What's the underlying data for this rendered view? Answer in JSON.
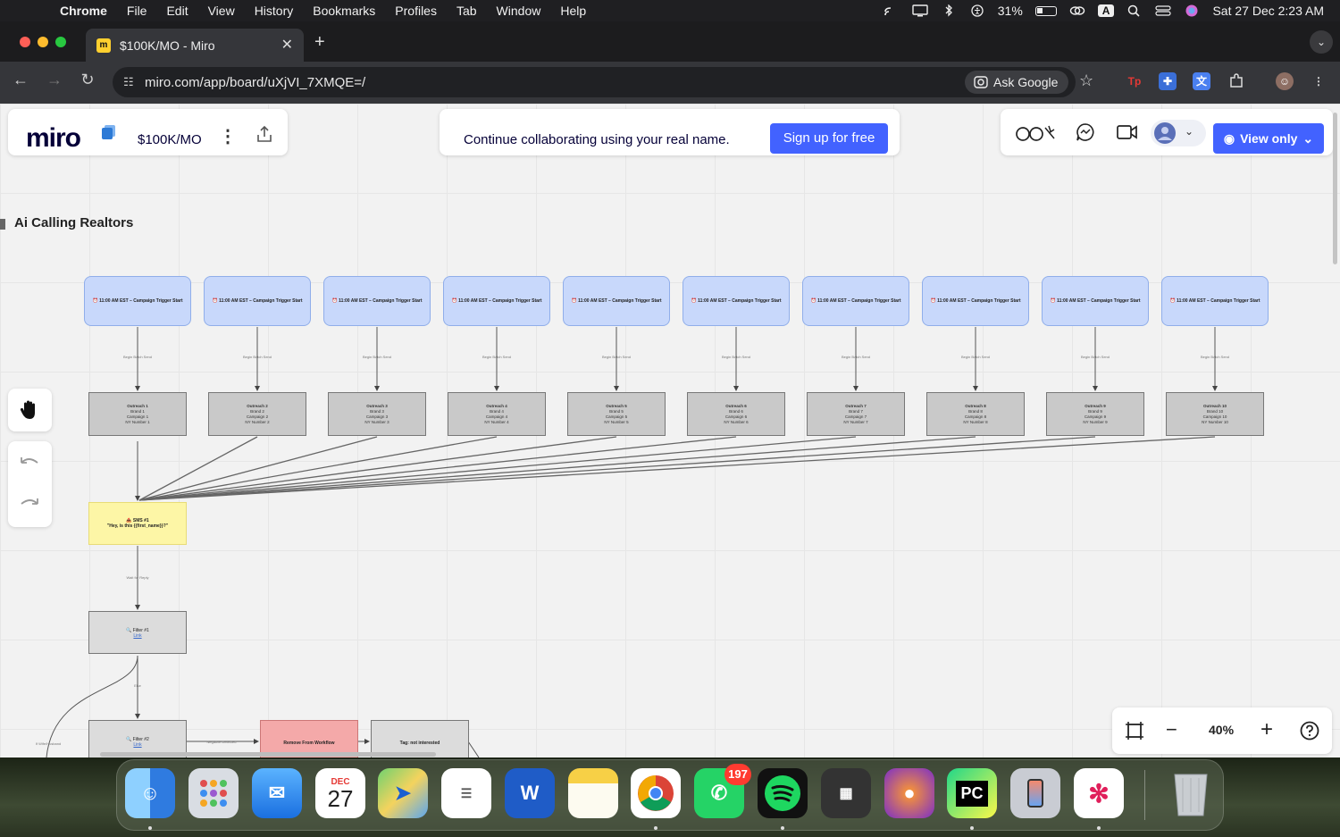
{
  "menubar": {
    "app": "Chrome",
    "items": [
      "File",
      "Edit",
      "View",
      "History",
      "Bookmarks",
      "Profiles",
      "Tab",
      "Window",
      "Help"
    ],
    "battery": "31%",
    "input_source": "A",
    "datetime": "Sat 27 Dec  2:23 AM"
  },
  "browser": {
    "tab_title": "$100K/MO - Miro",
    "tab_favicon": "m",
    "url": "miro.com/app/board/uXjVI_7XMQE=/",
    "ask_google": "Ask Google",
    "extension_tp": "Tp"
  },
  "miro": {
    "logo": "miro",
    "board_name": "$100K/MO",
    "banner_text": "Continue collaborating using your real name.",
    "signup_label": "Sign up for free",
    "view_only_label": "View only",
    "frame_title": "Ai Calling Realtors",
    "zoom_level": "40%",
    "trigger_label": "⏰ 11:00 AM EST – Campaign Trigger Start",
    "edge_label": "Begin Batch Send",
    "outreach": [
      {
        "title": "Outreach 1",
        "lines": [
          "Brand 1",
          "Campaign 1",
          "NY Number 1"
        ]
      },
      {
        "title": "Outreach 2",
        "lines": [
          "Brand 2",
          "Campaign 2",
          "NY Number 2"
        ]
      },
      {
        "title": "Outreach 3",
        "lines": [
          "Brand 3",
          "Campaign 3",
          "NY Number 3"
        ]
      },
      {
        "title": "Outreach 4",
        "lines": [
          "Brand 4",
          "Campaign 4",
          "NY Number 4"
        ]
      },
      {
        "title": "Outreach 5",
        "lines": [
          "Brand 5",
          "Campaign 5",
          "NY Number 5"
        ]
      },
      {
        "title": "Outreach 6",
        "lines": [
          "Brand 6",
          "Campaign 6",
          "NY Number 6"
        ]
      },
      {
        "title": "Outreach 7",
        "lines": [
          "Brand 7",
          "Campaign 7",
          "NY Number 7"
        ]
      },
      {
        "title": "Outreach 8",
        "lines": [
          "Brand 8",
          "Campaign 8",
          "NY Number 8"
        ]
      },
      {
        "title": "Outreach 9",
        "lines": [
          "Brand 9",
          "Campaign 9",
          "NY Number 9"
        ]
      },
      {
        "title": "Outreach 10",
        "lines": [
          "Brand 10",
          "Campaign 10",
          "NY Number 10"
        ]
      }
    ],
    "sms": {
      "title": "📤 SMS #1",
      "body": "\"Hey, is this {{first_name}}?\""
    },
    "wait_label": "Wait for Reply",
    "filter1": {
      "title": "🔍 Filter #1",
      "link": "Link"
    },
    "else_label": "Else",
    "filter2": {
      "title": "🔍 Filter #2",
      "link": "Link"
    },
    "negative_label": "Negative Detected",
    "if_wife_label": "If Wife/Husband",
    "remove_label": "Remove From Workflow",
    "tag_label": "Tag: not interested"
  },
  "dock": {
    "calendar_month": "DEC",
    "calendar_day": "27",
    "whatsapp_badge": "197",
    "pycharm_label": "PC"
  }
}
